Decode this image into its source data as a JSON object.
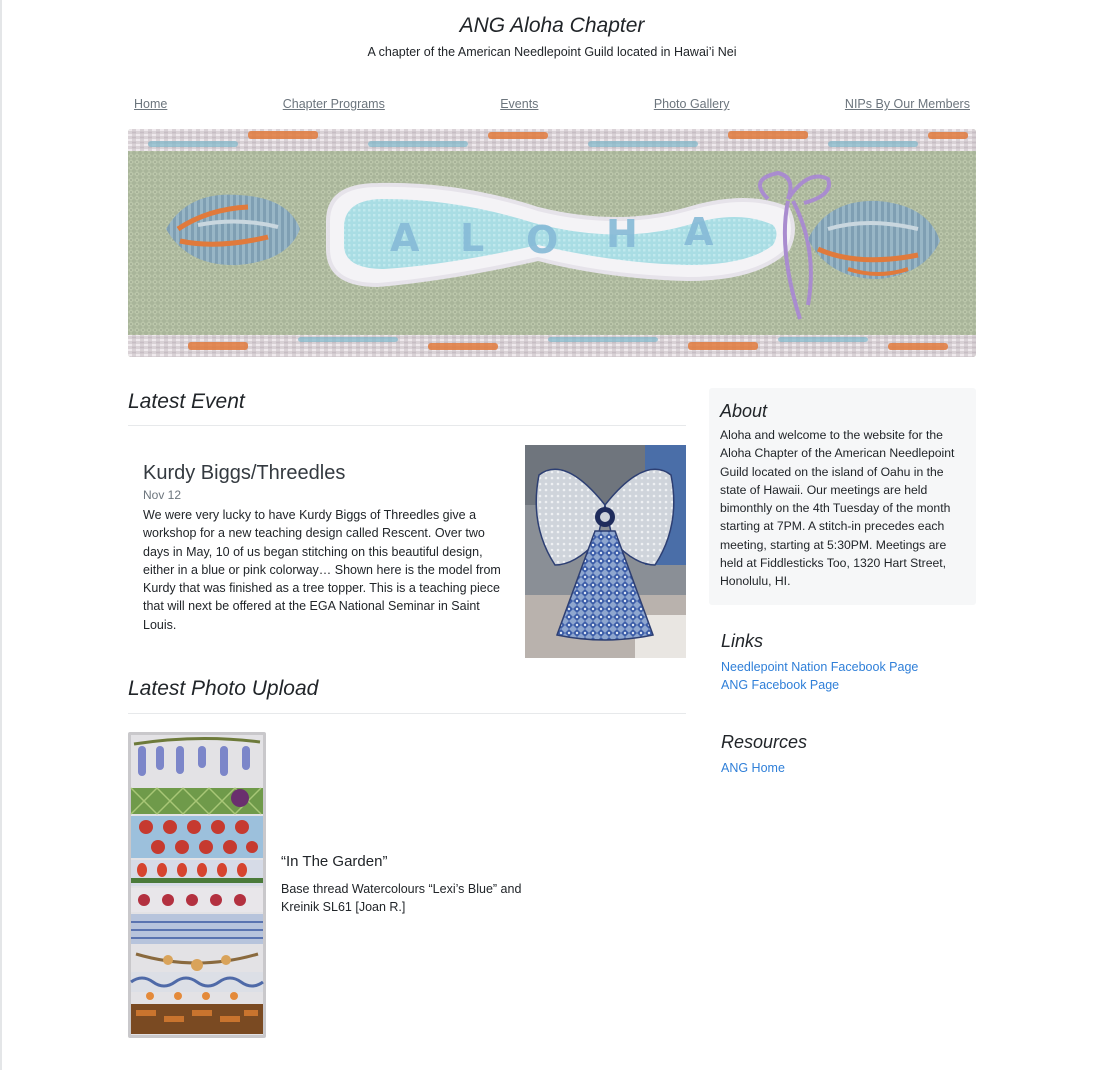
{
  "header": {
    "title": "ANG Aloha Chapter",
    "tagline": "A chapter of the American Needlepoint Guild located in Hawai’i Nei"
  },
  "nav": {
    "items": [
      "Home",
      "Chapter Programs",
      "Events",
      "Photo Gallery",
      "NIPs By Our Members"
    ]
  },
  "banner": {
    "alt": "Needlepoint banner with seashells and the word ALOHA"
  },
  "latest_event": {
    "heading": "Latest Event",
    "title": "Kurdy Biggs/Threedles",
    "date": "Nov 12",
    "body": "We were very lucky to have Kurdy Biggs of Threedles give a workshop for a new teaching design called Rescent. Over two days in May, 10 of us began stitching on this beautiful design, either in a blue or pink colorway… Shown here is the model from Kurdy that was finished as a tree topper. This is a teaching piece that will next be offered at the EGA National Seminar in Saint Louis."
  },
  "latest_photo": {
    "heading": "Latest Photo Upload",
    "title": "“In The Garden”",
    "description": "Base thread Watercolours “Lexi’s Blue” and Kreinik SL61 [Joan R.]"
  },
  "sidebar": {
    "about": {
      "title": "About",
      "text": "Aloha and welcome to the website for the Aloha Chapter of the American Needlepoint Guild located on the island of Oahu in the state of Hawaii. Our meetings are held bimonthly on the 4th Tuesday of the month starting at 7PM. A stitch-in precedes each meeting, starting at 5:30PM. Meetings are held at Fiddlesticks Too, 1320 Hart Street, Honolulu, HI."
    },
    "links": {
      "title": "Links",
      "items": [
        "Needlepoint Nation Facebook Page",
        "ANG Facebook Page"
      ]
    },
    "resources": {
      "title": "Resources",
      "items": [
        "ANG Home"
      ]
    }
  },
  "colors": {
    "link": "#2f7fd8",
    "nav_link": "#6c757d",
    "sidebar_bg": "#f6f7f8"
  }
}
